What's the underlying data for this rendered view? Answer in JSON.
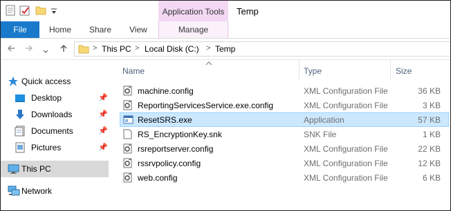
{
  "window": {
    "title": "Temp"
  },
  "quick_access_toolbar": {
    "items": [
      "properties-icon",
      "new-folder-icon",
      "folder-icon",
      "customize-dropdown-icon"
    ]
  },
  "ribbon": {
    "contextual_group_label": "Application Tools",
    "tabs": [
      {
        "label": "File",
        "active": true
      },
      {
        "label": "Home"
      },
      {
        "label": "Share"
      },
      {
        "label": "View"
      },
      {
        "label": "Manage",
        "contextual": true
      }
    ]
  },
  "address_bar": {
    "breadcrumbs": [
      "This PC",
      "Local Disk (C:)",
      "Temp"
    ],
    "separator": ">"
  },
  "navigation_pane": {
    "items": [
      {
        "label": "Quick access",
        "icon": "star-icon"
      },
      {
        "label": "Desktop",
        "icon": "desktop-icon",
        "pinned": true
      },
      {
        "label": "Downloads",
        "icon": "download-arrow-icon",
        "pinned": true
      },
      {
        "label": "Documents",
        "icon": "documents-icon",
        "pinned": true
      },
      {
        "label": "Pictures",
        "icon": "pictures-icon",
        "pinned": true
      },
      {
        "label": "This PC",
        "icon": "computer-icon",
        "selected": true
      },
      {
        "label": "Network",
        "icon": "network-icon"
      }
    ]
  },
  "file_list": {
    "columns": [
      "Name",
      "Type",
      "Size"
    ],
    "sort_column": "Name",
    "rows": [
      {
        "name": "machine.config",
        "type": "XML Configuration File",
        "size": "36 KB",
        "icon": "config-file-icon"
      },
      {
        "name": "ReportingServicesService.exe.config",
        "type": "XML Configuration File",
        "size": "3 KB",
        "icon": "config-file-icon"
      },
      {
        "name": "ResetSRS.exe",
        "type": "Application",
        "size": "57 KB",
        "icon": "application-icon",
        "selected": true
      },
      {
        "name": "RS_EncryptionKey.snk",
        "type": "SNK File",
        "size": "1 KB",
        "icon": "blank-file-icon"
      },
      {
        "name": "rsreportserver.config",
        "type": "XML Configuration File",
        "size": "22 KB",
        "icon": "config-file-icon"
      },
      {
        "name": "rssrvpolicy.config",
        "type": "XML Configuration File",
        "size": "12 KB",
        "icon": "config-file-icon"
      },
      {
        "name": "web.config",
        "type": "XML Configuration File",
        "size": "6 KB",
        "icon": "config-file-icon"
      }
    ]
  },
  "colors": {
    "file_tab": "#1979ca",
    "contextual_tab": "#f3d8f3",
    "selection": "#cce8ff",
    "selection_border": "#99d1ff"
  }
}
